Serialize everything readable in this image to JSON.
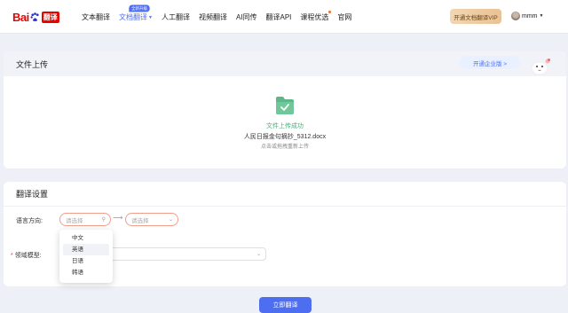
{
  "header": {
    "logo_text": "Bai",
    "logo_suffix": "翻译",
    "nav": [
      {
        "label": "文本翻译"
      },
      {
        "label": "文档翻译",
        "badge": "全新升级"
      },
      {
        "label": "人工翻译"
      },
      {
        "label": "视频翻译"
      },
      {
        "label": "AI同传"
      },
      {
        "label": "翻译API"
      },
      {
        "label": "课程优选"
      },
      {
        "label": "官网"
      }
    ],
    "vip_button": "开通文档翻译VIP",
    "username": "mmm"
  },
  "upload": {
    "title": "文件上传",
    "enterprise_button": "开通企业版 >",
    "status": "文件上传成功",
    "filename": "人民日报金句摘抄_5312.docx",
    "hint": "点击或拖拽重新上传"
  },
  "settings": {
    "title": "翻译设置",
    "language_label": "语言方向:",
    "source_placeholder": "请选择",
    "target_placeholder": "请选择",
    "domain_label": "领域模型:",
    "language_options": [
      "中文",
      "英语",
      "日语",
      "韩语"
    ]
  },
  "translate_button": "立即翻译",
  "colors": {
    "accent": "#4e6ef2",
    "brand_red": "#e10602",
    "success_green": "#4bae7a"
  }
}
